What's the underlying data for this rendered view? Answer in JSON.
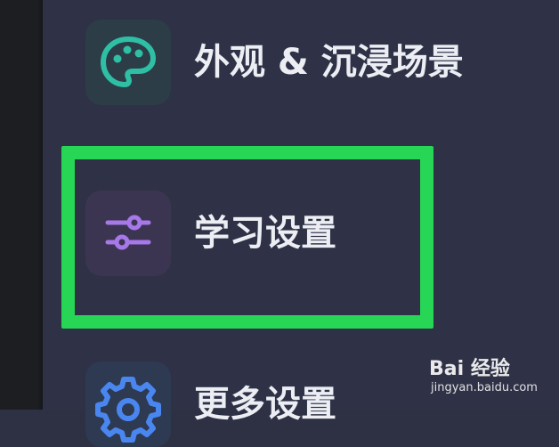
{
  "menu": {
    "items": [
      {
        "label": "外观 & 沉浸场景",
        "icon": "palette-icon",
        "icon_color": "#2ebfa5"
      },
      {
        "label": "学习设置",
        "icon": "sliders-icon",
        "icon_color": "#a678e8",
        "highlighted": true
      },
      {
        "label": "更多设置",
        "icon": "gear-icon",
        "icon_color": "#4a86f0"
      }
    ]
  },
  "highlight_color": "#27d654",
  "watermark": {
    "logo_text": "Bai 经验",
    "url_text": "jingyan.baidu.com"
  }
}
